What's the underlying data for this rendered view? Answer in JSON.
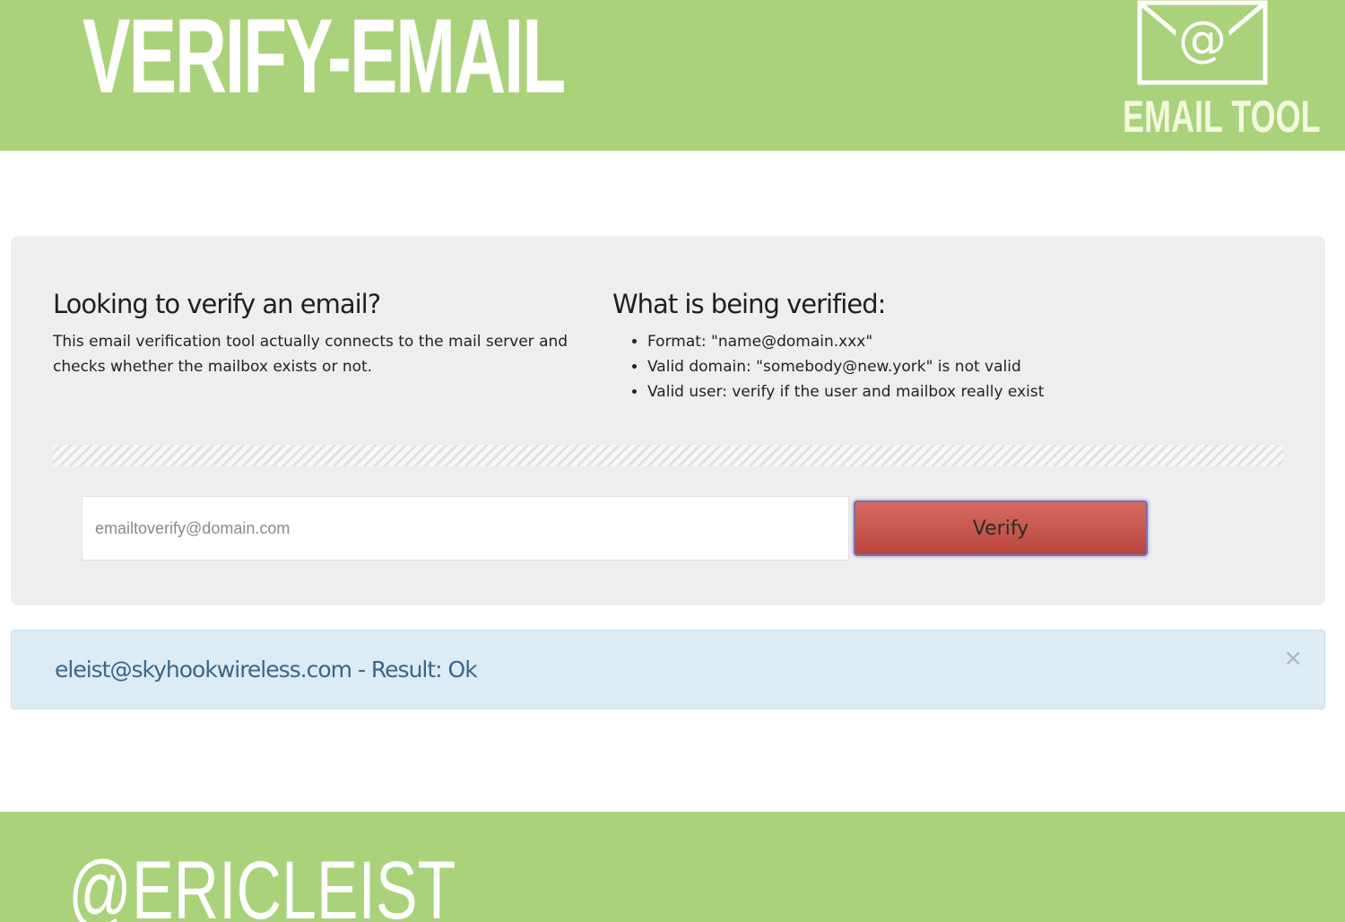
{
  "header": {
    "title": "VERIFY-EMAIL",
    "brand_label": "EMAIL TOOL",
    "brand_icon": "envelope-at-icon"
  },
  "intro": {
    "heading": "Looking to verify an email?",
    "text": "This email verification tool actually connects to the mail server and checks whether the mailbox exists or not."
  },
  "verified": {
    "heading": "What is being verified:",
    "items": [
      "Format: \"name@domain.xxx\"",
      "Valid domain: \"somebody@new.york\" is not valid",
      "Valid user: verify if the user and mailbox really exist"
    ]
  },
  "form": {
    "email_placeholder": "emailtoverify@domain.com",
    "email_value": "",
    "verify_label": "Verify"
  },
  "result": {
    "text": "eleist@skyhookwireless.com - Result: Ok",
    "close_label": "×"
  },
  "footer": {
    "handle": "@ERICLEIST"
  },
  "colors": {
    "header_green": "#a9d27a",
    "button_red": "#c4534a",
    "alert_blue": "#dcebf4"
  }
}
